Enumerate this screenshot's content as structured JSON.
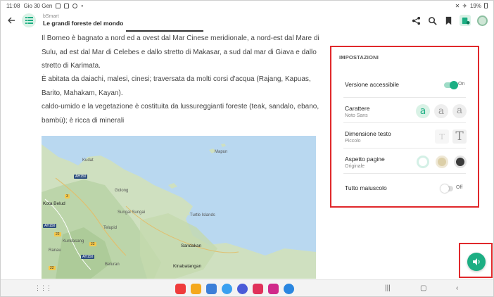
{
  "status_bar": {
    "time": "11:08",
    "date": "Gio 30 Gen",
    "battery": "19%"
  },
  "header": {
    "app_name": "bSmart",
    "book_title": "Le grandi foreste del mondo",
    "icons": [
      "back-arrow-icon",
      "toc-icon",
      "share-icon",
      "search-icon",
      "bookmark-icon",
      "reader-settings-icon",
      "avatar"
    ]
  },
  "content": {
    "paragraph_1": "Il Borneo è bagnato a nord ed a ovest dal Mar Cinese meridionale, a nord-est dal Mare di Sulu, ad est dal Mar di Celebes e dallo stretto di Makasar, a sud dal mar di Giava e dallo stretto di Karimata.",
    "paragraph_2": "È abitata da daiachi, malesi, cinesi; traversata da molti corsi d'acqua (Rajang, Kapuas, Barito, Mahakam, Kayan).",
    "paragraph_3": "caldo-umido e la vegetazione è costituita da lussureggianti foreste (teak, sandalo, ebano, bambù); è ricca di minerali"
  },
  "map": {
    "labels": {
      "kudat": "Kudat",
      "mapun": "Mapun",
      "kota_belud": "Kota Belud",
      "golong": "Golong",
      "sungai_sungai": "Sungai Sungai",
      "turtle_islands": "Turtle Islands",
      "sandakan": "Sandakan",
      "kundasang": "Kundasang",
      "beluran": "Beluran",
      "kinabatangan": "Kinabatangan",
      "telupid": "Telupid",
      "ranau": "Ranau"
    },
    "road_shields": [
      "AH150",
      "AH150",
      "AH150"
    ],
    "road_numbers": [
      "3",
      "22",
      "22",
      "22"
    ]
  },
  "settings": {
    "heading": "IMPOSTAZIONI",
    "accessible_version": {
      "label": "Versione accessibile",
      "state": "On",
      "enabled": true
    },
    "font": {
      "label": "Carattere",
      "value": "Noto Sans",
      "options": [
        "a",
        "a",
        "a"
      ],
      "selected_index": 0
    },
    "text_size": {
      "label": "Dimensione testo",
      "value": "Piccolo",
      "options": [
        "T",
        "T"
      ],
      "selected_index": 0
    },
    "page_theme": {
      "label": "Aspetto pagine",
      "value": "Originale",
      "selected_index": 0
    },
    "uppercase": {
      "label": "Tutto maiuscolo",
      "state": "Off",
      "enabled": false
    }
  },
  "audio_button": {
    "icon": "speaker-icon"
  },
  "colors": {
    "accent": "#1cae83",
    "highlight": "#e0282b",
    "theme_original": "#ffffff",
    "theme_sepia": "#dccfa8",
    "theme_dark": "#3b3b3b"
  },
  "nav_bar": {
    "dock_apps": [
      "app-1",
      "app-2",
      "app-3",
      "app-4",
      "app-5",
      "app-6",
      "app-7",
      "app-8"
    ],
    "buttons": [
      "recents-button",
      "home-button",
      "back-button"
    ]
  }
}
